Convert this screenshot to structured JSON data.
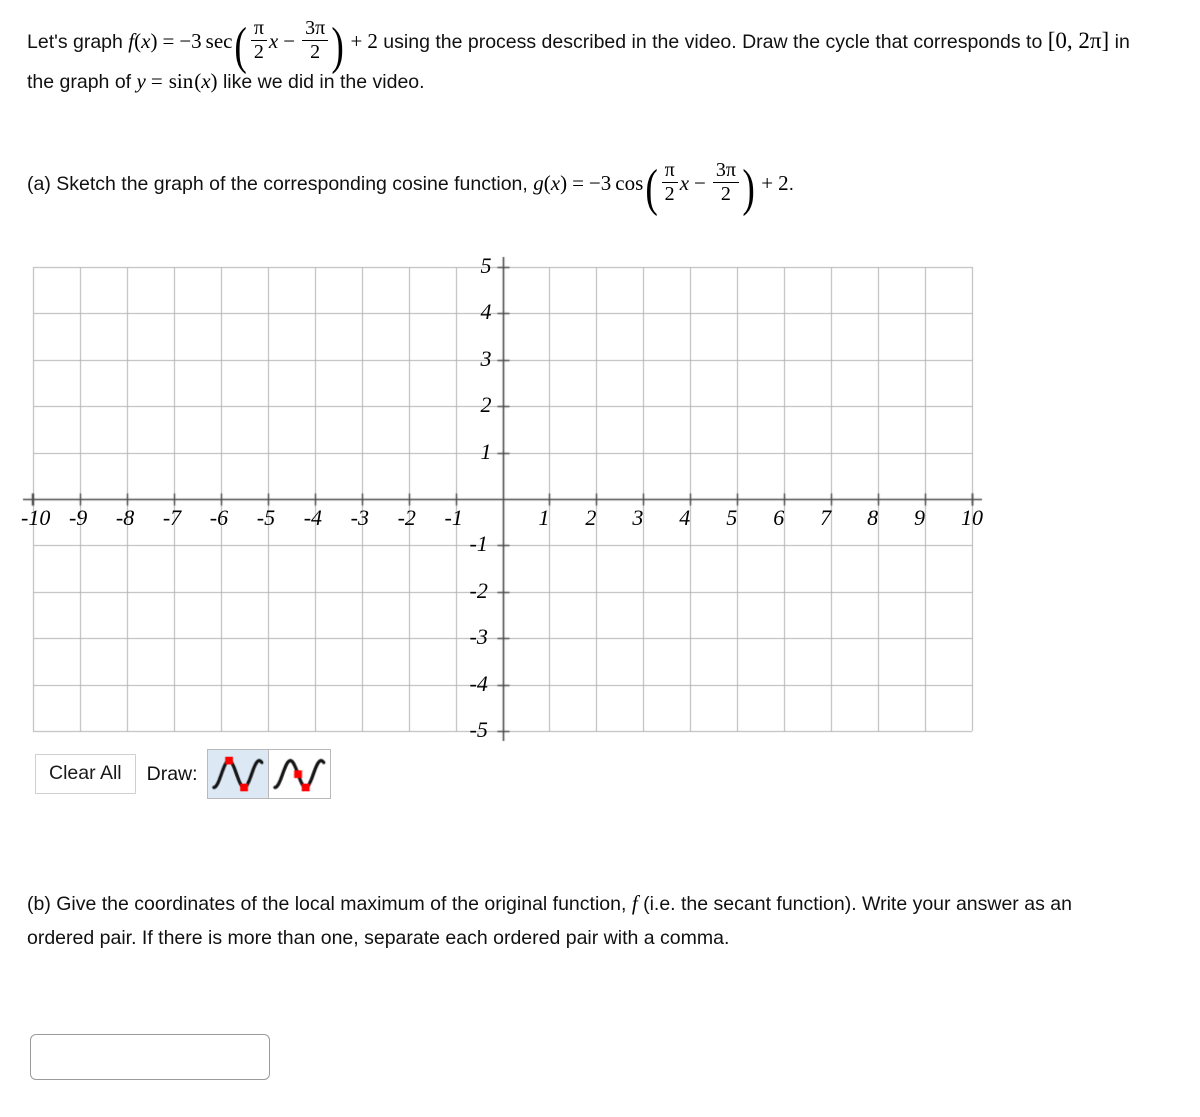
{
  "intro": {
    "text_before": "Let's graph",
    "fn_name": "f",
    "fn_var": "x",
    "equals": "=",
    "coefficient": "−3",
    "trig": "sec",
    "arg_coef_num": "π",
    "arg_coef_den": "2",
    "arg_var": "x",
    "arg_minus": "−",
    "arg_shift_num": "3π",
    "arg_shift_den": "2",
    "plus": "+",
    "vertical_shift": "2",
    "text_after": "using the process described in the video. Draw the",
    "line2_a": "cycle that corresponds to",
    "interval": "[0, 2π]",
    "line2_b": "in the graph of",
    "y_eq": "y = sin(x)",
    "line2_c": "like we did in the video."
  },
  "part_a": {
    "prefix": "(a) Sketch the graph of the corresponding cosine function,",
    "fn_name": "g",
    "fn_var": "x",
    "equals": "=",
    "coefficient": "−3",
    "trig": "cos",
    "arg_coef_num": "π",
    "arg_coef_den": "2",
    "arg_var": "x",
    "arg_minus": "−",
    "arg_shift_num": "3π",
    "arg_shift_den": "2",
    "plus": "+",
    "vertical_shift": "2",
    "period": "."
  },
  "part_b": {
    "line1": "(b) Give the coordinates of the local maximum of the original function,",
    "fn_name": "f",
    "line1_end": "(i.e. the secant function).",
    "line2": "Write your answer as an ordered pair. If there is more than one, separate each ordered pair with a",
    "line3": "comma."
  },
  "toolbar": {
    "clear_all_label": "Clear All",
    "draw_label": "Draw:",
    "tools": [
      {
        "name": "sine-peak-trough-tool",
        "selected": true
      },
      {
        "name": "sine-peak-midline-tool",
        "selected": false
      }
    ],
    "marker_color": "#ff0000",
    "selected_bg": "#dce9f5"
  },
  "answer": {
    "value": "",
    "placeholder": ""
  },
  "chart_data": {
    "type": "scatter",
    "title": "",
    "xlabel": "",
    "ylabel": "",
    "xlim": [
      -10,
      10
    ],
    "ylim": [
      -5,
      5
    ],
    "grid": true,
    "grid_step_x": 1,
    "grid_step_y": 1,
    "x_ticks": [
      -10,
      -9,
      -8,
      -7,
      -6,
      -5,
      -4,
      -3,
      -2,
      -1,
      1,
      2,
      3,
      4,
      5,
      6,
      7,
      8,
      9,
      10
    ],
    "x_tick_labels": [
      "-10",
      "-9",
      "-8",
      "-7",
      "-6",
      "-5",
      "-4",
      "-3",
      "-2",
      "-1",
      "1",
      "2",
      "3",
      "4",
      "5",
      "6",
      "7",
      "8",
      "9",
      "10"
    ],
    "y_ticks": [
      5,
      4,
      3,
      2,
      1,
      -1,
      -2,
      -3,
      -4,
      -5
    ],
    "y_tick_labels": [
      "5",
      "4",
      "3",
      "2",
      "1",
      "-1",
      "-2",
      "-3",
      "-4",
      "-5"
    ],
    "series": [],
    "grid_color": "#b3b3b3",
    "axis_color": "#4d4d4d",
    "legend": "none",
    "annotations": []
  }
}
